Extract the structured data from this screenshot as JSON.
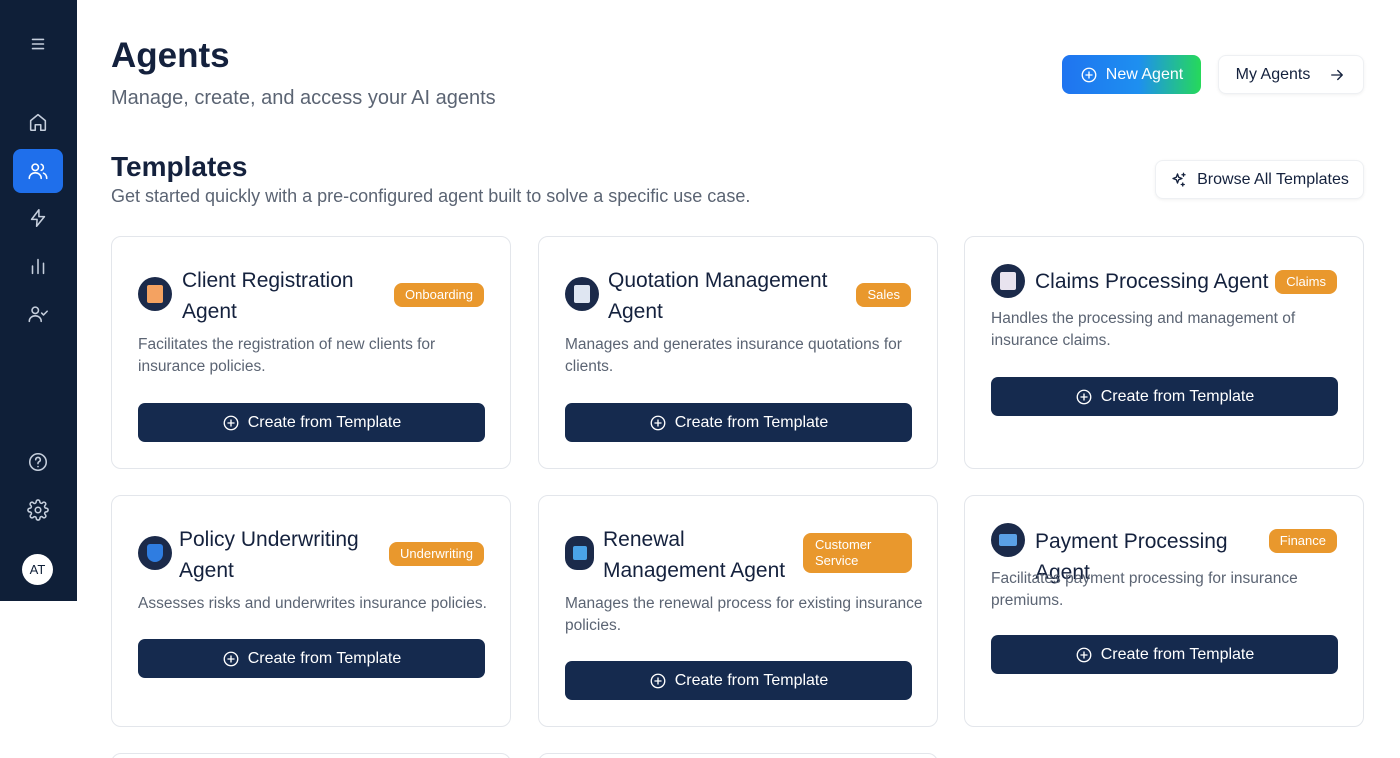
{
  "sidebar": {
    "items": [
      {
        "icon": "menu-icon"
      },
      {
        "icon": "home-icon"
      },
      {
        "icon": "users-icon",
        "active": true
      },
      {
        "icon": "lightning-icon"
      },
      {
        "icon": "bar-chart-icon"
      },
      {
        "icon": "user-check-icon"
      },
      {
        "icon": "help-icon"
      },
      {
        "icon": "settings-icon"
      }
    ],
    "avatar_initials": "AT"
  },
  "header": {
    "title": "Agents",
    "subtitle": "Manage, create, and access your AI agents",
    "new_agent_label": "New Agent",
    "my_agents_label": "My Agents"
  },
  "templates": {
    "title": "Templates",
    "subtitle": "Get started quickly with a pre-configured agent built to solve a specific use case.",
    "browse_label": "Browse All Templates",
    "create_label": "Create from Template",
    "cards": [
      {
        "title": "Client Registration Agent",
        "badge": "Onboarding",
        "description": "Facilitates the registration of new clients for insurance policies.",
        "icon": "registration-icon",
        "icon_color": "#f4a261"
      },
      {
        "title": "Quotation Management Agent",
        "badge": "Sales",
        "description": "Manages and generates insurance quotations for clients.",
        "icon": "document-icon",
        "icon_color": "#dfe6f2"
      },
      {
        "title": "Claims Processing Agent",
        "badge": "Claims",
        "description": "Handles the processing and management of insurance claims.",
        "icon": "claims-icon",
        "icon_color": "#e8e3ef"
      },
      {
        "title": "Policy Underwriting Agent",
        "badge": "Underwriting",
        "description": "Assesses risks and underwrites insurance policies.",
        "icon": "shield-icon",
        "icon_color": "#2f7de1"
      },
      {
        "title": "Renewal Management Agent",
        "badge": "Customer Service",
        "description": "Manages the renewal process for existing insurance policies.",
        "icon": "renew-icon",
        "icon_color": "#4aa3e8"
      },
      {
        "title": "Payment Processing Agent",
        "badge": "Finance",
        "description": "Facilitates payment processing for insurance premiums.",
        "icon": "credit-card-icon",
        "icon_color": "#5aa0e6"
      }
    ]
  }
}
